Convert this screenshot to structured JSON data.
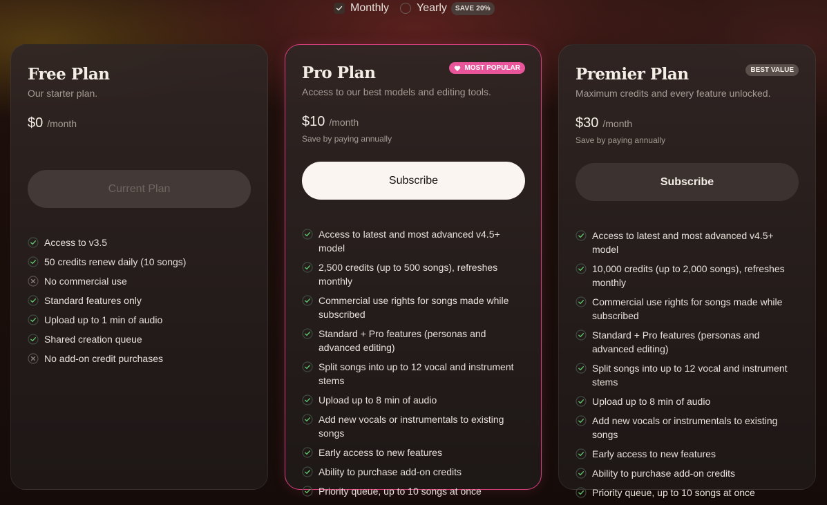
{
  "billing": {
    "monthly_label": "Monthly",
    "yearly_label": "Yearly",
    "save_badge": "SAVE 20%",
    "selected": "Monthly"
  },
  "colors": {
    "accent_pink": "#e8559a",
    "check_green": "#5fc46b",
    "card_bg": "#2a2220"
  },
  "plans": [
    {
      "title": "Free Plan",
      "description": "Our starter plan.",
      "price": "$0",
      "per": "/month",
      "price_note": "",
      "button_label": "Current Plan",
      "badge": "",
      "features": [
        {
          "text": "Access to v3.5",
          "included": true
        },
        {
          "text": "50 credits renew daily (10 songs)",
          "included": true
        },
        {
          "text": "No commercial use",
          "included": false
        },
        {
          "text": "Standard features only",
          "included": true
        },
        {
          "text": "Upload up to 1 min of audio",
          "included": true
        },
        {
          "text": "Shared creation queue",
          "included": true
        },
        {
          "text": "No add-on credit purchases",
          "included": false
        }
      ]
    },
    {
      "title": "Pro Plan",
      "description": "Access to our best models and editing tools.",
      "price": "$10",
      "per": "/month",
      "price_note": "Save by paying annually",
      "button_label": "Subscribe",
      "badge": "MOST POPULAR",
      "features": [
        {
          "text": "Access to latest and most advanced v4.5+ model",
          "included": true
        },
        {
          "text": "2,500 credits (up to 500 songs), refreshes monthly",
          "included": true
        },
        {
          "text": "Commercial use rights for songs made while subscribed",
          "included": true
        },
        {
          "text": "Standard + Pro features (personas and advanced editing)",
          "included": true
        },
        {
          "text": "Split songs into up to 12 vocal and instrument stems",
          "included": true
        },
        {
          "text": "Upload up to 8 min of audio",
          "included": true
        },
        {
          "text": "Add new vocals or instrumentals to existing songs",
          "included": true
        },
        {
          "text": "Early access to new features",
          "included": true
        },
        {
          "text": "Ability to purchase add-on credits",
          "included": true
        },
        {
          "text": "Priority queue, up to 10 songs at once",
          "included": true
        }
      ]
    },
    {
      "title": "Premier Plan",
      "description": "Maximum credits and every feature unlocked.",
      "price": "$30",
      "per": "/month",
      "price_note": "Save by paying annually",
      "button_label": "Subscribe",
      "badge": "BEST VALUE",
      "features": [
        {
          "text": "Access to latest and most advanced v4.5+ model",
          "included": true
        },
        {
          "text": "10,000 credits (up to 2,000 songs), refreshes monthly",
          "included": true
        },
        {
          "text": "Commercial use rights for songs made while subscribed",
          "included": true
        },
        {
          "text": "Standard + Pro features (personas and advanced editing)",
          "included": true
        },
        {
          "text": "Split songs into up to 12 vocal and instrument stems",
          "included": true
        },
        {
          "text": "Upload up to 8 min of audio",
          "included": true
        },
        {
          "text": "Add new vocals or instrumentals to existing songs",
          "included": true
        },
        {
          "text": "Early access to new features",
          "included": true
        },
        {
          "text": "Ability to purchase add-on credits",
          "included": true
        },
        {
          "text": "Priority queue, up to 10 songs at once",
          "included": true
        }
      ]
    }
  ]
}
